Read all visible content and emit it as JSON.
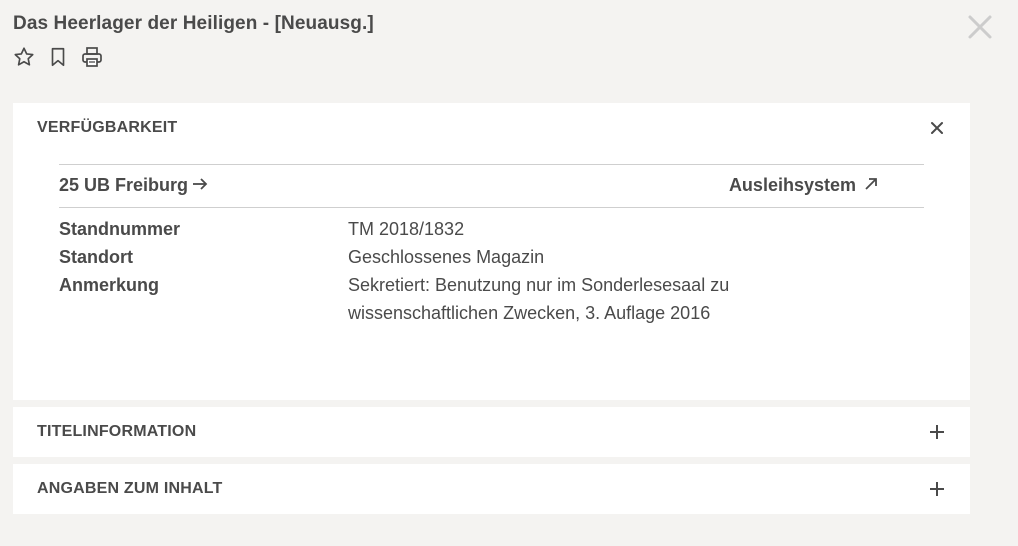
{
  "title": "Das Heerlager der Heiligen - [Neuausg.]",
  "icons": {
    "close": "close-icon",
    "favorite": "star-icon",
    "bookmark": "bookmark-icon",
    "print": "printer-icon"
  },
  "sections": {
    "availability": {
      "title": "VERFÜGBARKEIT",
      "toggle": "×",
      "location": "25 UB Freiburg",
      "loan_link": "Ausleihsystem",
      "fields": [
        {
          "label": "Standnummer",
          "value": "TM 2018/1832"
        },
        {
          "label": "Standort",
          "value": "Geschlossenes Magazin"
        },
        {
          "label": "Anmerkung",
          "value": "Sekretiert: Benutzung nur im Sonderlesesaal zu wissenschaftlichen Zwecken, 3. Auflage 2016"
        }
      ]
    },
    "title_info": {
      "title": "TITELINFORMATION",
      "toggle": "+"
    },
    "content_info": {
      "title": "ANGABEN ZUM INHALT",
      "toggle": "+"
    }
  },
  "colors": {
    "background": "#f4f3f1",
    "panel": "#ffffff",
    "text": "#4a4a4a",
    "close_light": "#cccccc"
  }
}
